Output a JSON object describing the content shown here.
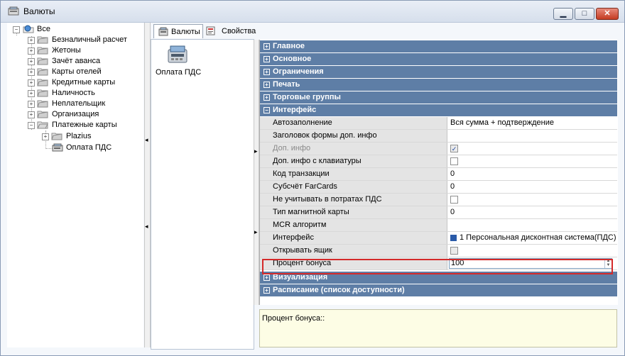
{
  "window": {
    "title": "Валюты",
    "minimize_glyph": "▁",
    "maximize_glyph": "□",
    "close_glyph": "✕"
  },
  "tree": {
    "root": {
      "label": "Все"
    },
    "items": [
      {
        "label": "Безналичный расчет"
      },
      {
        "label": "Жетоны"
      },
      {
        "label": "Зачёт аванса"
      },
      {
        "label": "Карты отелей"
      },
      {
        "label": "Кредитные карты"
      },
      {
        "label": "Наличность"
      },
      {
        "label": "Неплательщик"
      },
      {
        "label": "Организация"
      },
      {
        "label": "Платежные карты"
      }
    ],
    "children": [
      {
        "label": "Plazius"
      },
      {
        "label": "Оплата ПДС"
      }
    ]
  },
  "tabs": [
    {
      "label": "Валюты"
    },
    {
      "label": "Свойства"
    }
  ],
  "icon_panel": {
    "item_label": "Оплата ПДС"
  },
  "property_grid": {
    "categories_top": [
      {
        "label": "Главное"
      },
      {
        "label": "Основное"
      },
      {
        "label": "Ограничения"
      },
      {
        "label": "Печать"
      },
      {
        "label": "Торговые группы"
      },
      {
        "label": "Интерфейс"
      }
    ],
    "rows": [
      {
        "name": "Автозаполнение",
        "value": "Вся сумма + подтверждение"
      },
      {
        "name": "Заголовок формы доп. инфо",
        "value": ""
      },
      {
        "name": "Доп. инфо",
        "value": "",
        "checked": true
      },
      {
        "name": "Доп. инфо с клавиатуры",
        "value": "",
        "checked": false
      },
      {
        "name": "Код транзакции",
        "value": "0"
      },
      {
        "name": "Субсчёт FarCards",
        "value": "0"
      },
      {
        "name": "Не учитывать в потратах ПДС",
        "value": "",
        "checked": false
      },
      {
        "name": "Тип магнитной карты",
        "value": "0"
      },
      {
        "name": "MCR алгоритм",
        "value": ""
      },
      {
        "name": "Интерфейс",
        "value": "1 Персональная дисконтная система(ПДС)"
      },
      {
        "name": "Открывать ящик",
        "value": "",
        "checked": false
      },
      {
        "name": "Процент бонуса",
        "value": "100"
      }
    ],
    "categories_bottom": [
      {
        "label": "Визуализация"
      },
      {
        "label": "Расписание (список доступности)"
      }
    ],
    "expanded_box": "−",
    "collapsed_box": "+",
    "check_mark": "✓"
  },
  "help": {
    "text": "Процент бонуса::"
  },
  "colors": {
    "category_bar": "#5e7ea6",
    "highlight": "#d42a2a",
    "help_bg": "#fdfde5"
  }
}
